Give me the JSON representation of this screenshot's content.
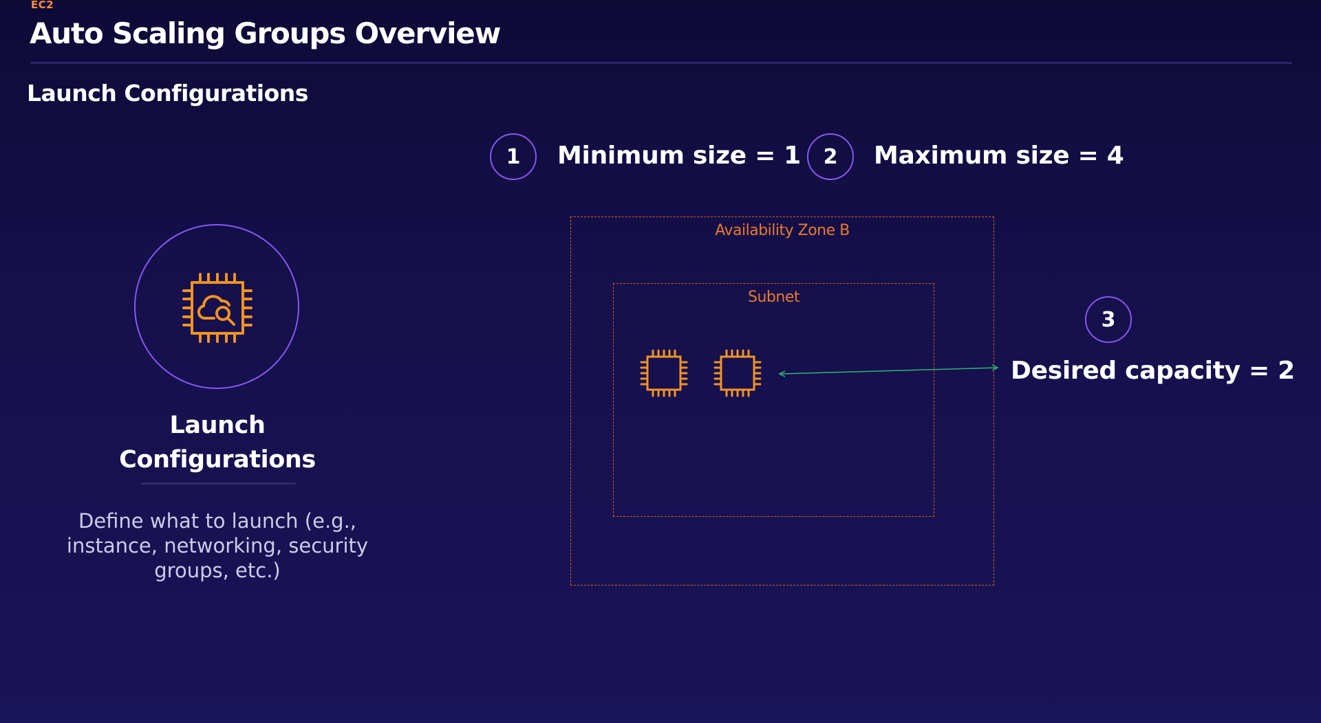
{
  "header": {
    "eyebrow": "EC2",
    "title": "Auto Scaling Groups Overview"
  },
  "section": {
    "title": "Launch Configurations"
  },
  "feature": {
    "icon": "ec2-launch-configuration-icon",
    "title_line1": "Launch",
    "title_line2": "Configurations",
    "description": "Define what to launch (e.g., instance, networking, security groups, etc.)"
  },
  "stats": [
    {
      "number": "1",
      "label": "Minimum size = 1"
    },
    {
      "number": "2",
      "label": "Maximum size = 4"
    },
    {
      "number": "3",
      "label": "Desired capacity = 2"
    }
  ],
  "diagram": {
    "availability_zone": "Availability Zone B",
    "subnet": "Subnet",
    "instances": [
      "ec2-instance-icon",
      "ec2-instance-icon"
    ]
  },
  "colors": {
    "background": "#150f4a",
    "accent_purple": "#8757f2",
    "aws_orange": "#e87a2e",
    "connector_green": "#2bb673",
    "eyebrow_orange": "#ff8f3f"
  }
}
